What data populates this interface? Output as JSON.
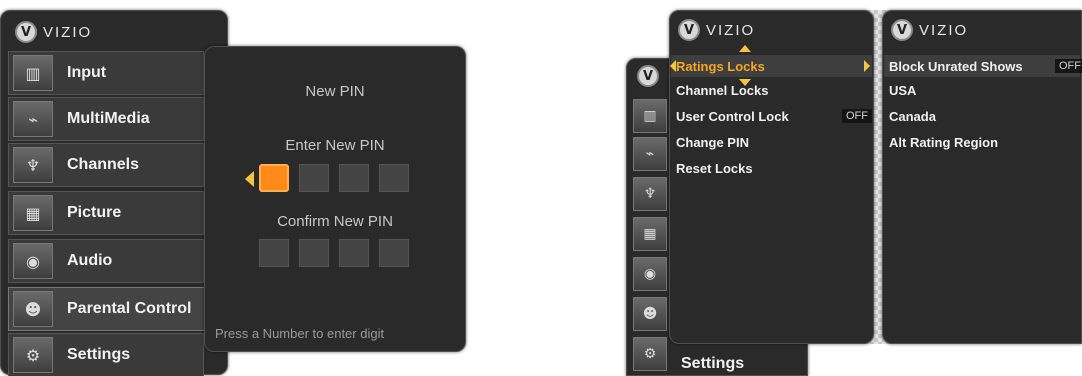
{
  "brand": {
    "logo_letter": "V",
    "logo_text": "VIZIO"
  },
  "left_screen": {
    "menu": [
      {
        "label": "Input",
        "icon": "input-icon",
        "glyph": "▥"
      },
      {
        "label": "MultiMedia",
        "icon": "usb-icon",
        "glyph": "⌁"
      },
      {
        "label": "Channels",
        "icon": "antenna-icon",
        "glyph": "♆"
      },
      {
        "label": "Picture",
        "icon": "picture-icon",
        "glyph": "▦"
      },
      {
        "label": "Audio",
        "icon": "speaker-icon",
        "glyph": "◉"
      },
      {
        "label": "Parental Control",
        "icon": "parents-icon",
        "glyph": "☻"
      },
      {
        "label": "Settings",
        "icon": "settings-icon",
        "glyph": "⚙"
      }
    ],
    "pin_dialog": {
      "title": "New PIN",
      "enter_label": "Enter New PIN",
      "confirm_label": "Confirm New PIN",
      "hint": "Press a Number to enter digit"
    }
  },
  "right_screen": {
    "collapsed_menu_letter": "V",
    "collapsed_settings_label": "Settings",
    "parental_menu": {
      "items": [
        {
          "label": "Ratings Locks",
          "selected": true
        },
        {
          "label": "Channel Locks"
        },
        {
          "label": "User Control Lock",
          "value": "OFF"
        },
        {
          "label": "Change PIN"
        },
        {
          "label": "Reset Locks"
        }
      ]
    },
    "ratings_menu": {
      "items": [
        {
          "label": "Block Unrated Shows",
          "value": "OFF"
        },
        {
          "label": "USA"
        },
        {
          "label": "Canada"
        },
        {
          "label": "Alt Rating Region"
        }
      ]
    }
  },
  "colors": {
    "accent": "#f5a623",
    "panel": "#2a2a2a",
    "pin_active": "#ff8a1a"
  }
}
